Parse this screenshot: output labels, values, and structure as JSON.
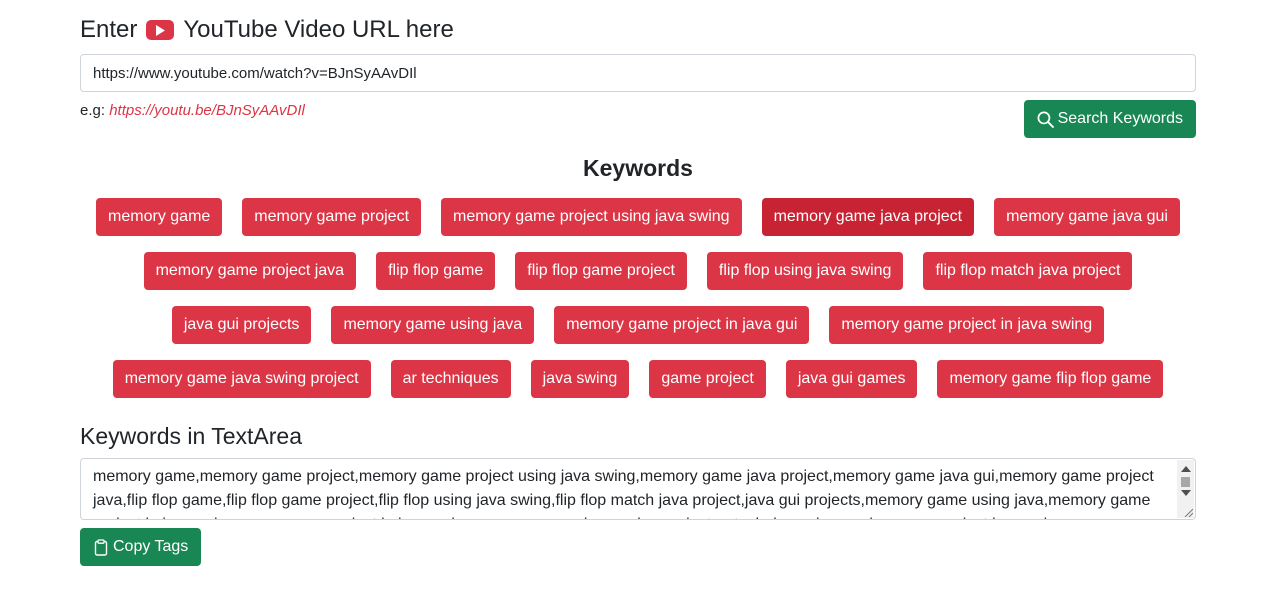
{
  "header": {
    "prefix": "Enter",
    "icon": "youtube-play-icon",
    "suffix": "YouTube Video URL here"
  },
  "url_input": {
    "value": "https://www.youtube.com/watch?v=BJnSyAAvDIl"
  },
  "example": {
    "label": "e.g:",
    "link": "https://youtu.be/BJnSyAAvDIl"
  },
  "search_button": {
    "icon": "search-icon",
    "label": "Search Keywords"
  },
  "keywords_section": {
    "title": "Keywords",
    "rows": [
      [
        "memory game",
        "memory game project",
        "memory game project using java swing",
        "memory game java project",
        "memory game java gui"
      ],
      [
        "memory game project java",
        "flip flop game",
        "flip flop game project",
        "flip flop using java swing",
        "flip flop match java project"
      ],
      [
        "java gui projects",
        "memory game using java",
        "memory game project in java gui",
        "memory game project in java swing"
      ],
      [
        "memory game java swing project",
        "ar techniques",
        "java swing",
        "game project",
        "java gui games",
        "memory game flip flop game"
      ]
    ],
    "active_keyword": "memory game java project"
  },
  "textarea_section": {
    "title": "Keywords in TextArea",
    "text": "memory game,memory game project,memory game project using java swing,memory game java project,memory game java gui,memory game project java,flip flop game,flip flop game project,flip flop using java swing,flip flop match java project,java gui projects,memory game using java,memory game project in java gui,memory game project in java swing,memory game java swing project,ar techniques,java swing,game project,java gui games,memory game flip flop game"
  },
  "copy_button": {
    "icon": "clipboard-icon",
    "label": "Copy Tags"
  },
  "colors": {
    "danger": "#dc3545",
    "success": "#198754",
    "text": "#212529",
    "border": "#ced4da"
  }
}
